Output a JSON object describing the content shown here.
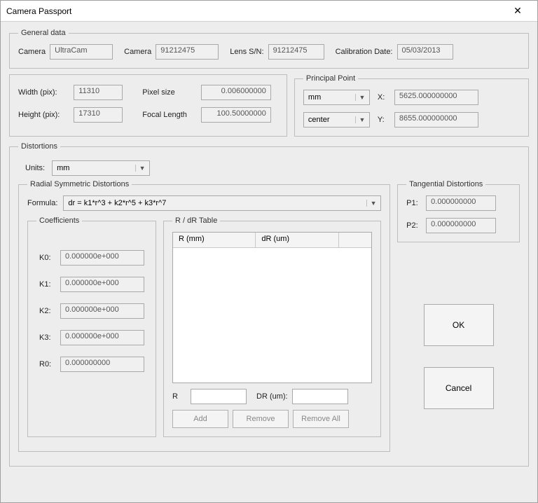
{
  "window": {
    "title": "Camera Passport"
  },
  "general": {
    "legend": "General data",
    "camera_label": "Camera",
    "camera_value": "UltraCam",
    "camera2_label": "Camera",
    "camera2_value": "91212475",
    "lens_label": "Lens S/N:",
    "lens_value": "91212475",
    "cal_label": "Calibration Date:",
    "cal_value": "05/03/2013"
  },
  "dims": {
    "width_label": "Width (pix):",
    "width_value": "11310",
    "pixel_label": "Pixel size",
    "pixel_value": "0.006000000",
    "height_label": "Height (pix):",
    "height_value": "17310",
    "focal_label": "Focal Length",
    "focal_value": "100.50000000"
  },
  "pp": {
    "legend": "Principal Point",
    "unit": "mm",
    "origin": "center",
    "x_label": "X:",
    "x_value": "5625.000000000",
    "y_label": "Y:",
    "y_value": "8655.000000000"
  },
  "distortions": {
    "legend": "Distortions",
    "units_label": "Units:",
    "units_value": "mm"
  },
  "radial": {
    "legend": "Radial Symmetric Distortions",
    "formula_label": "Formula:",
    "formula_value": "dr = k1*r^3 + k2*r^5 + k3*r^7",
    "coef_legend": "Coefficients",
    "k0_label": "K0:",
    "k0": "0.000000e+000",
    "k1_label": "K1:",
    "k1": "0.000000e+000",
    "k2_label": "K2:",
    "k2": "0.000000e+000",
    "k3_label": "K3:",
    "k3": "0.000000e+000",
    "r0_label": "R0:",
    "r0": "0.000000000",
    "table_legend": "R / dR Table",
    "col_r": "R (mm)",
    "col_dr": "dR (um)",
    "r_label": "R",
    "dr_label": "DR (um):",
    "r_value": "",
    "dr_value": "",
    "add": "Add",
    "remove": "Remove",
    "remove_all": "Remove All"
  },
  "tangential": {
    "legend": "Tangential Distortions",
    "p1_label": "P1:",
    "p1": "0.000000000",
    "p2_label": "P2:",
    "p2": "0.000000000"
  },
  "buttons": {
    "ok": "OK",
    "cancel": "Cancel"
  }
}
